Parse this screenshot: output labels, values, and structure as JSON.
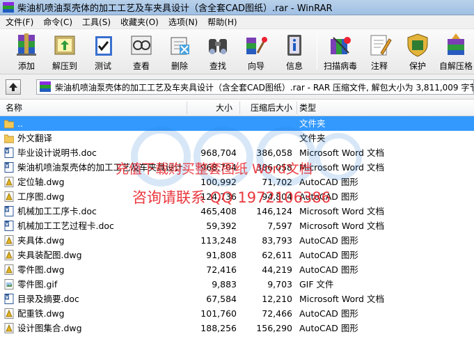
{
  "window": {
    "title": "柴油机喷油泵壳体的加工工艺及车夹具设计（含全套CAD图纸）.rar - WinRAR"
  },
  "menu": [
    {
      "label": "文件(F)"
    },
    {
      "label": "命令(C)"
    },
    {
      "label": "工具(S)"
    },
    {
      "label": "收藏夹(O)"
    },
    {
      "label": "选项(N)"
    },
    {
      "label": "帮助(H)"
    }
  ],
  "toolbar": [
    {
      "label": "添加",
      "icon": "add-archive-icon"
    },
    {
      "label": "解压到",
      "icon": "extract-to-icon"
    },
    {
      "label": "测试",
      "icon": "test-icon"
    },
    {
      "label": "查看",
      "icon": "view-icon"
    },
    {
      "label": "删除",
      "icon": "delete-icon"
    },
    {
      "label": "查找",
      "icon": "find-icon"
    },
    {
      "label": "向导",
      "icon": "wizard-icon"
    },
    {
      "label": "信息",
      "icon": "info-icon"
    },
    {
      "label": "扫描病毒",
      "icon": "virus-scan-icon"
    },
    {
      "label": "注释",
      "icon": "comment-icon"
    },
    {
      "label": "保护",
      "icon": "protect-icon"
    },
    {
      "label": "自解压格",
      "icon": "sfx-icon"
    }
  ],
  "address": {
    "text": "柴油机喷油泵壳体的加工工艺及车夹具设计（含全套CAD图纸）.rar - RAR 压缩文件, 解包大小为 3,811,009 字节"
  },
  "columns": {
    "name": "名称",
    "size": "大小",
    "packed": "压缩后大小",
    "type": "类型"
  },
  "files": [
    {
      "name": "..",
      "size": "",
      "packed": "",
      "type": "文件夹",
      "icon": "folder-up-icon"
    },
    {
      "name": "外文翻译",
      "size": "",
      "packed": "",
      "type": "文件夹",
      "icon": "folder-icon"
    },
    {
      "name": "毕业设计说明书.doc",
      "size": "968,704",
      "packed": "386,058",
      "type": "Microsoft Word 文档",
      "icon": "word-doc-icon"
    },
    {
      "name": "柴油机喷油泵壳体的加工工艺及车夹具设计...",
      "size": "968,704",
      "packed": "386,058",
      "type": "Microsoft Word 文档",
      "icon": "word-doc-icon"
    },
    {
      "name": "定位轴.dwg",
      "size": "100,992",
      "packed": "71,702",
      "type": "AutoCAD 图形",
      "icon": "autocad-dwg-icon"
    },
    {
      "name": "工序图.dwg",
      "size": "124,736",
      "packed": "94,804",
      "type": "AutoCAD 图形",
      "icon": "autocad-dwg-icon"
    },
    {
      "name": "机械加工工序卡.doc",
      "size": "465,408",
      "packed": "146,124",
      "type": "Microsoft Word 文档",
      "icon": "word-doc-icon"
    },
    {
      "name": "机械加工工艺过程卡.doc",
      "size": "59,392",
      "packed": "7,597",
      "type": "Microsoft Word 文档",
      "icon": "word-doc-icon"
    },
    {
      "name": "夹具体.dwg",
      "size": "113,248",
      "packed": "83,793",
      "type": "AutoCAD 图形",
      "icon": "autocad-dwg-icon"
    },
    {
      "name": "夹具装配图.dwg",
      "size": "91,808",
      "packed": "62,611",
      "type": "AutoCAD 图形",
      "icon": "autocad-dwg-icon"
    },
    {
      "name": "零件图.dwg",
      "size": "72,416",
      "packed": "44,219",
      "type": "AutoCAD 图形",
      "icon": "autocad-dwg-icon"
    },
    {
      "name": "零件图.gif",
      "size": "9,883",
      "packed": "9,703",
      "type": "GIF 文件",
      "icon": "gif-image-icon"
    },
    {
      "name": "目录及摘要.doc",
      "size": "67,584",
      "packed": "12,210",
      "type": "Microsoft Word 文档",
      "icon": "word-doc-icon"
    },
    {
      "name": "配重铁.dwg",
      "size": "101,760",
      "packed": "72,466",
      "type": "AutoCAD 图形",
      "icon": "autocad-dwg-icon"
    },
    {
      "name": "设计图集合.dwg",
      "size": "188,256",
      "packed": "156,290",
      "type": "AutoCAD 图形",
      "icon": "autocad-dwg-icon"
    }
  ],
  "watermark": {
    "line1": "充值下载购买整套图纸  Word文档",
    "line2": "咨询请联系   QQ 1972106386"
  },
  "colors": {
    "selection": "#3399ff",
    "watermark": "#e8232a",
    "folder": "#f3c95a",
    "word": "#2b5797",
    "autocad": "#e6b422"
  }
}
